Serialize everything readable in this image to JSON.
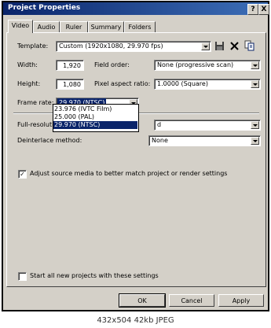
{
  "window": {
    "title": "Project Properties",
    "help_btn": "?",
    "close_btn": "X"
  },
  "tabs": [
    {
      "label": "Video",
      "selected": true
    },
    {
      "label": "Audio"
    },
    {
      "label": "Ruler"
    },
    {
      "label": "Summary"
    },
    {
      "label": "Folders"
    }
  ],
  "template": {
    "label": "Template:",
    "value": "Custom (1920x1080, 29.970 fps)"
  },
  "width": {
    "label": "Width:",
    "value": "1,920"
  },
  "height": {
    "label": "Height:",
    "value": "1,080"
  },
  "field_order": {
    "label": "Field order:",
    "value": "None (progressive scan)"
  },
  "pixel_aspect": {
    "label": "Pixel aspect ratio:",
    "value": "1.0000 (Square)"
  },
  "frame_rate": {
    "label": "Frame rate:",
    "value": "29.970 (NTSC)",
    "options": [
      "23.976 (IVTC Film)",
      "25.000 (PAL)",
      "29.970 (NTSC)"
    ],
    "highlighted_index": 2
  },
  "full_res": {
    "label": "Full-resolution",
    "value": "d"
  },
  "deinterlace": {
    "label": "Deinterlace method:",
    "value": "None"
  },
  "adjust_source": {
    "label": "Adjust source media to better match project or render settings",
    "checked": true
  },
  "start_new": {
    "label": "Start all new projects with these settings",
    "checked": false
  },
  "buttons": {
    "ok": "OK",
    "cancel": "Cancel",
    "apply": "Apply"
  },
  "footer": "432x504  42kb  JPEG",
  "colors": {
    "titlebar": "#0a246a",
    "face": "#d4d0c8",
    "highlight": "#0a246a"
  }
}
